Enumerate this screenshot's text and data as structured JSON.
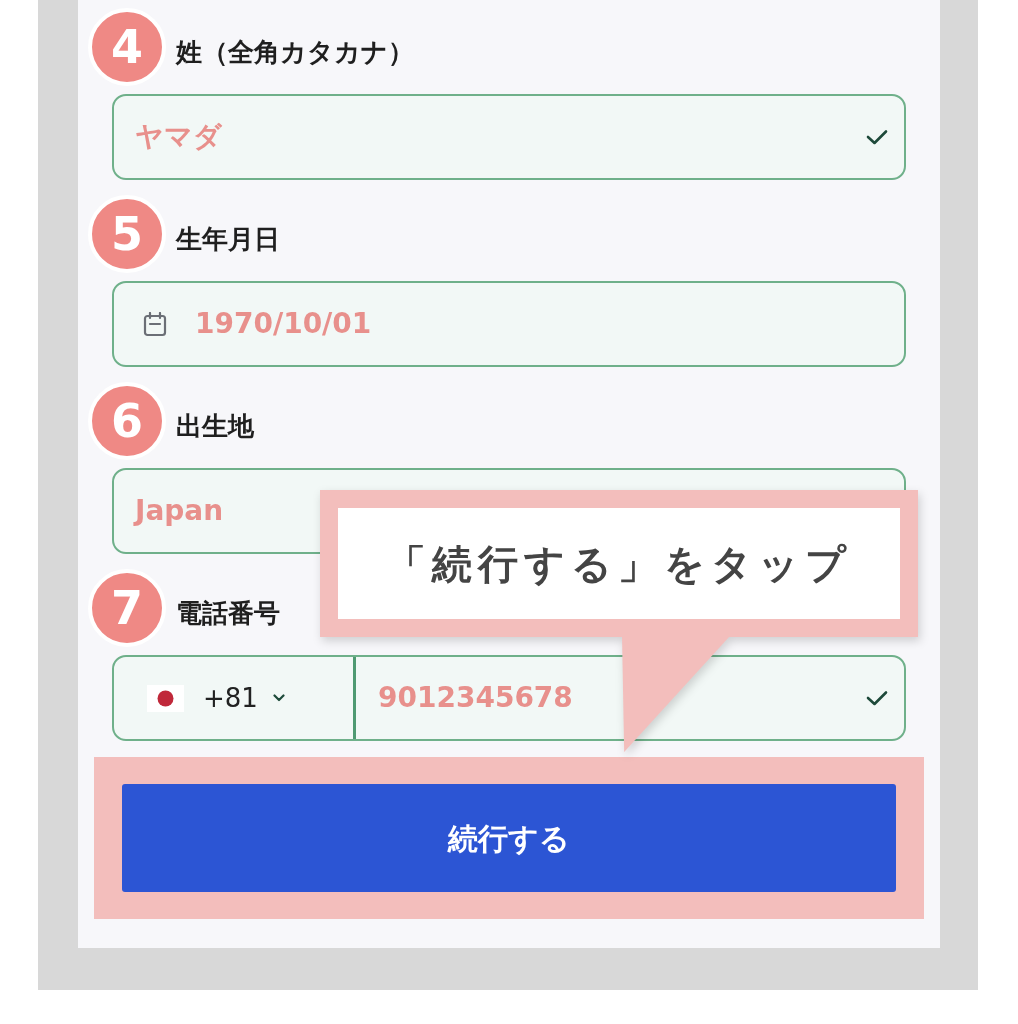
{
  "steps": [
    {
      "number": "4",
      "label": "姓（全角カタカナ）",
      "field": {
        "kind": "text",
        "value": "ヤマダ",
        "verified": true
      }
    },
    {
      "number": "5",
      "label": "生年月日",
      "field": {
        "kind": "date",
        "value": "1970/10/01",
        "verified": false
      }
    },
    {
      "number": "6",
      "label": "出生地",
      "field": {
        "kind": "text",
        "value": "Japan"
      }
    },
    {
      "number": "7",
      "label": "電話番号",
      "field": {
        "kind": "phone",
        "country_code": "+81",
        "value": "9012345678",
        "verified": true
      }
    }
  ],
  "continue_button": {
    "label": "続行する",
    "highlighted": true
  },
  "callout": {
    "text": "「続行する」をタップ"
  }
}
